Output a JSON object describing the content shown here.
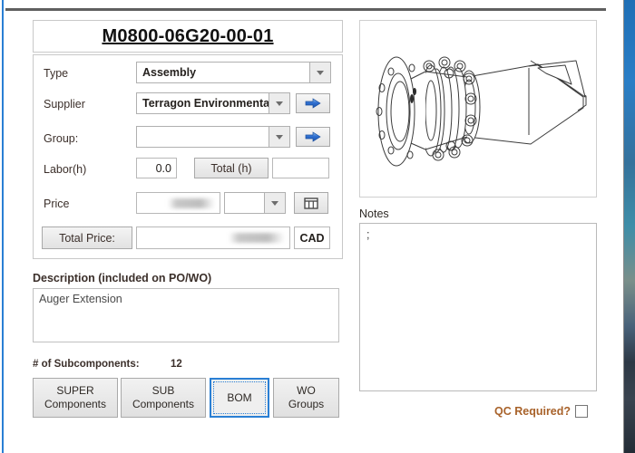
{
  "header": {
    "part_number": "M0800-06G20-00-01"
  },
  "form": {
    "type": {
      "label": "Type",
      "value": "Assembly"
    },
    "supplier": {
      "label": "Supplier",
      "value": "Terragon Environmenta",
      "goto_icon": "blue-right-arrow-icon"
    },
    "group": {
      "label": "Group:",
      "value": "",
      "goto_icon": "blue-right-arrow-icon"
    },
    "labor": {
      "label": "Labor(h)",
      "value": "0.0"
    },
    "total_hours": {
      "button_label": "Total (h)",
      "value": ""
    },
    "price": {
      "label": "Price",
      "value": "",
      "redacted": true,
      "currency_unit": "",
      "calc_icon": "table-calculator-icon"
    },
    "total_price": {
      "button_label": "Total Price:",
      "value": "",
      "redacted": true,
      "currency": "CAD"
    }
  },
  "description": {
    "label": "Description (included on PO/WO)",
    "value": "Auger Extension"
  },
  "subcomponents": {
    "label": "# of Subcomponents:",
    "count": "12"
  },
  "tabs": [
    {
      "line1": "SUPER",
      "line2": "Components",
      "focused": false
    },
    {
      "line1": "SUB",
      "line2": "Components",
      "focused": false
    },
    {
      "line1": "BOM",
      "line2": "",
      "focused": true
    },
    {
      "line1": "WO",
      "line2": "Groups",
      "focused": false
    }
  ],
  "preview": {
    "alt": "technical line drawing of flanged auger extension assembly"
  },
  "notes": {
    "label": "Notes",
    "value": ";"
  },
  "qc": {
    "label": "QC Required?",
    "checked": false
  },
  "colors": {
    "accent_blue": "#2a7fd4",
    "label_brown": "#3b2f2a",
    "qc_orange": "#a8622a"
  }
}
